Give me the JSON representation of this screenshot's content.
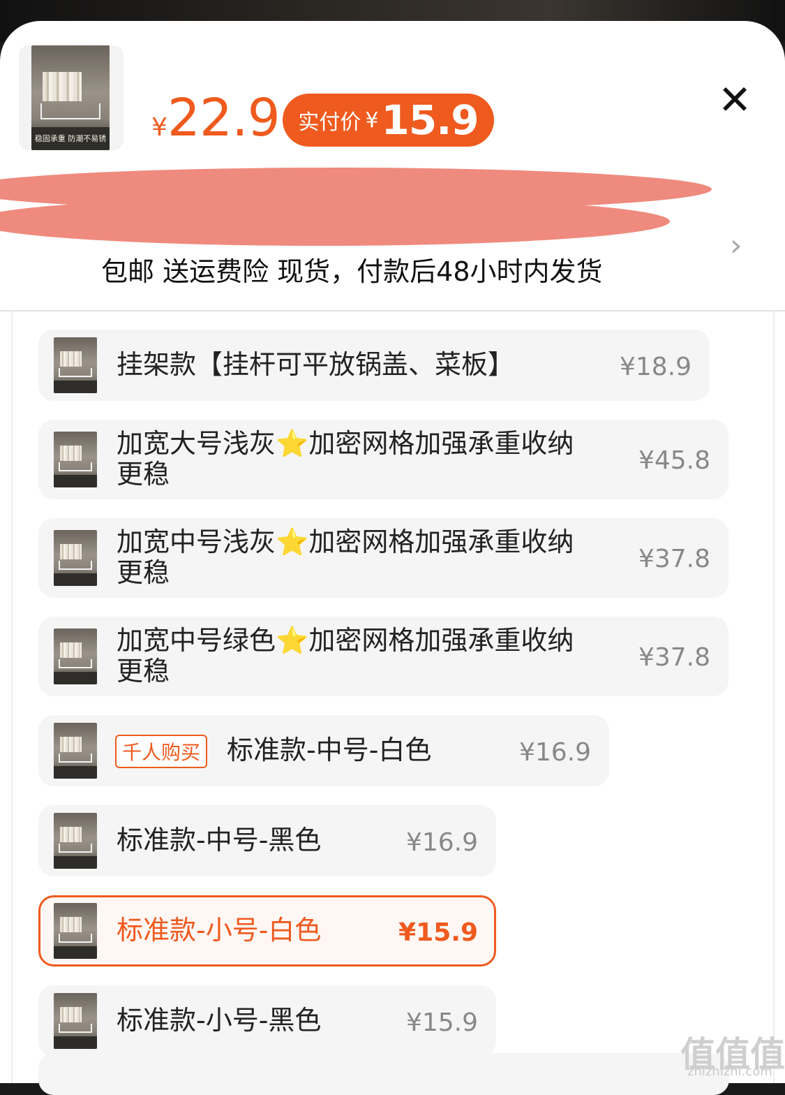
{
  "product": {
    "thumb_caption": "稳固承重 防潮不易锈",
    "orig_price_symbol": "¥",
    "orig_price": "22.9",
    "pay_label": "实付价",
    "pay_symbol": "¥",
    "pay_price": "15.9"
  },
  "shipping": {
    "text": "包邮  送运费险  现货，付款后48小时内发货"
  },
  "options": [
    {
      "label": "挂架款【挂杆可平放锅盖、菜板】",
      "price": "¥18.9"
    },
    {
      "label": "加宽大号浅灰⭐加密网格加强承重收纳更稳",
      "price": "¥45.8"
    },
    {
      "label": "加宽中号浅灰⭐加密网格加强承重收纳更稳",
      "price": "¥37.8"
    },
    {
      "label": "加宽中号绿色⭐加密网格加强承重收纳更稳",
      "price": "¥37.8"
    },
    {
      "label": "标准款-中号-白色",
      "price": "¥16.9",
      "tag": "千人购买"
    },
    {
      "label": "标准款-中号-黑色",
      "price": "¥16.9"
    },
    {
      "label": "标准款-小号-白色",
      "price": "¥15.9",
      "selected": true
    },
    {
      "label": "标准款-小号-黑色",
      "price": "¥15.9"
    }
  ],
  "watermark": {
    "main": "值值值",
    "sub": "zhizhizhi.com"
  },
  "colors": {
    "accent": "#ef5a1e",
    "option_bg": "#f5f5f5",
    "price_muted": "#888888"
  },
  "icons": {
    "close": "close-icon",
    "chevron": "chevron-right-icon"
  }
}
